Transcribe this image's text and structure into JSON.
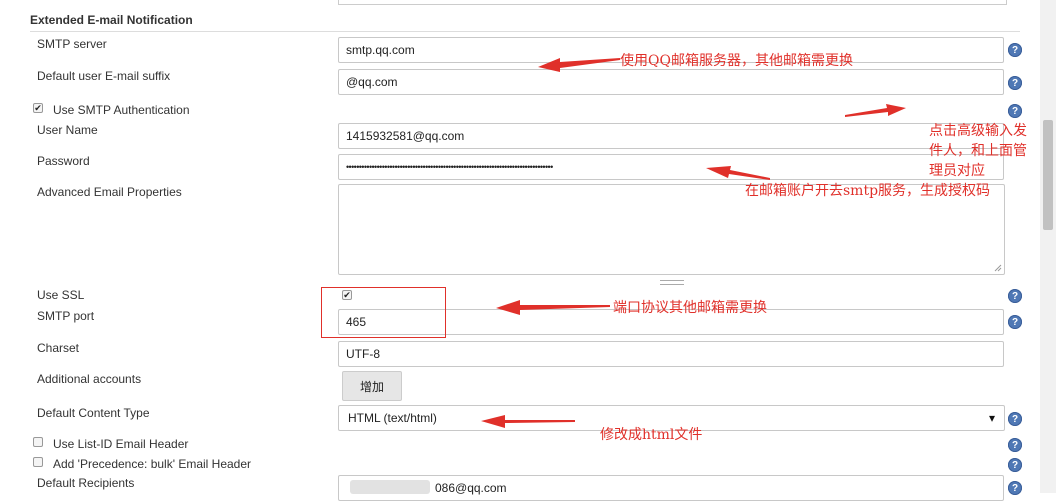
{
  "section": {
    "title": "Extended E-mail Notification"
  },
  "fields": {
    "smtp_server": {
      "label": "SMTP server",
      "value": "smtp.qq.com"
    },
    "default_suffix": {
      "label": "Default user E-mail suffix",
      "value": "@qq.com"
    },
    "use_smtp_auth": {
      "label": "Use SMTP Authentication",
      "checked": true
    },
    "user_name": {
      "label": "User Name",
      "value": "1415932581@qq.com"
    },
    "password": {
      "label": "Password",
      "value": "•••••••••••••••••••••••••••••••••••••••••••••••••••••••••••••••••••••••••••••••••"
    },
    "advanced_props": {
      "label": "Advanced Email Properties",
      "value": ""
    },
    "use_ssl": {
      "label": "Use SSL",
      "checked": true
    },
    "smtp_port": {
      "label": "SMTP port",
      "value": "465"
    },
    "charset": {
      "label": "Charset",
      "value": "UTF-8"
    },
    "additional_accounts": {
      "label": "Additional accounts",
      "button": "增加"
    },
    "content_type": {
      "label": "Default Content Type",
      "value": "HTML (text/html)"
    },
    "list_id": {
      "label": "Use List-ID Email Header",
      "checked": false
    },
    "precedence": {
      "label": "Add 'Precedence: bulk' Email Header",
      "checked": false
    },
    "recipients": {
      "label": "Default Recipients",
      "value": "086@qq.com"
    }
  },
  "help_glyph": "?",
  "check_glyph": "✔",
  "select_arrow": "▾",
  "annotations": {
    "note1": "使用QQ邮箱服务器，其他邮箱需更换",
    "note2_line1": "点击高级输入发",
    "note2_line2": "件人，和上面管",
    "note2_line3": "理员对应",
    "note3": "在邮箱账户开去smtp服务，生成授权码",
    "note4": "端口协议其他邮箱需更换",
    "note5": "修改成html文件"
  },
  "colors": {
    "annotation": "#e0302a",
    "help": "#4f78b5"
  }
}
